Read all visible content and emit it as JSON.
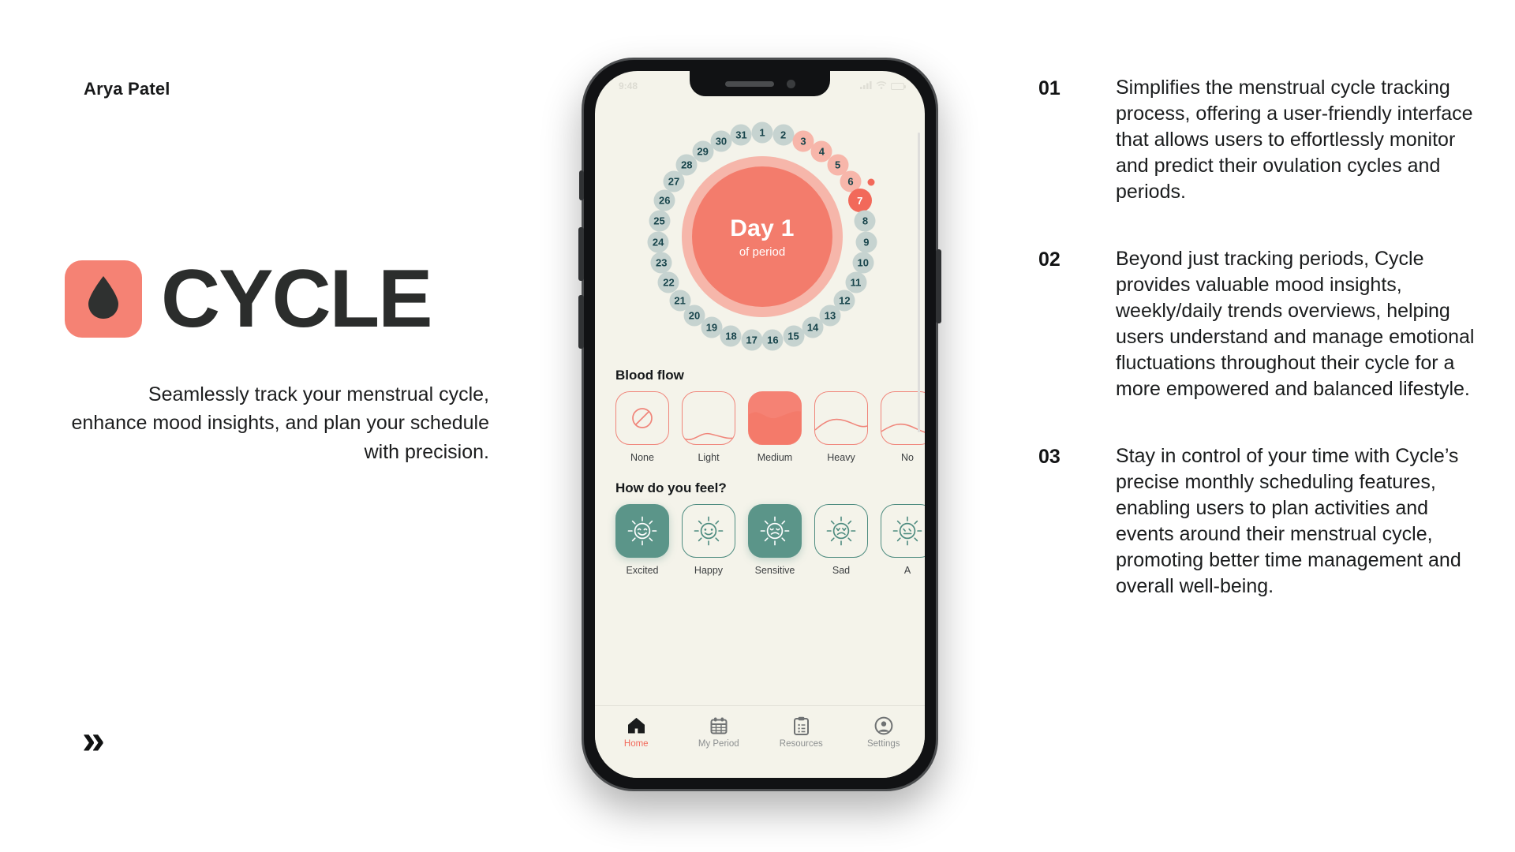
{
  "author": {
    "name": "Arya Patel"
  },
  "brand": {
    "name": "CYCLE",
    "logo_icon": "blood-drop-icon",
    "logo_bg": "#F58274",
    "tagline": "Seamlessly track your menstrual cycle, enhance mood insights, and plan your schedule with precision."
  },
  "footer": {
    "chevron": "»"
  },
  "phone": {
    "status_bar": {
      "time": "9:48",
      "icons": [
        "signal-icon",
        "wifi-icon",
        "battery-icon"
      ]
    },
    "cycle": {
      "center_day": "Day 1",
      "center_sub": "of period",
      "total_days": 31,
      "days": [
        1,
        2,
        3,
        4,
        5,
        6,
        7,
        8,
        9,
        10,
        11,
        12,
        13,
        14,
        15,
        16,
        17,
        18,
        19,
        20,
        21,
        22,
        23,
        24,
        25,
        26,
        27,
        28,
        29,
        30,
        31
      ],
      "flow_days": [
        3,
        4,
        5,
        6
      ],
      "today": 7,
      "colors": {
        "default_dot": "#C6D3D0",
        "flow_dot": "#F7B6AA",
        "today_dot": "#F2695A",
        "core": "#F37C6C",
        "core_glow": "#F6B6AA",
        "screen_bg": "#F4F3EA"
      }
    },
    "blood_flow": {
      "title": "Blood flow",
      "selected": "Medium",
      "options": [
        {
          "label": "None",
          "icon": "no-flow-icon",
          "state": "outline"
        },
        {
          "label": "Light",
          "icon": "light-flow-icon",
          "state": "outline"
        },
        {
          "label": "Medium",
          "icon": "medium-flow-icon",
          "state": "filled"
        },
        {
          "label": "Heavy",
          "icon": "heavy-flow-icon",
          "state": "outline"
        },
        {
          "label": "No",
          "icon": "extra-flow-icon",
          "state": "outline"
        }
      ]
    },
    "mood": {
      "title": "How do you feel?",
      "selected": [
        "Excited",
        "Sensitive"
      ],
      "options": [
        {
          "label": "Excited",
          "icon": "sun-grin-face-icon",
          "state": "selected"
        },
        {
          "label": "Happy",
          "icon": "sun-smile-face-icon",
          "state": "outline"
        },
        {
          "label": "Sensitive",
          "icon": "sun-uneasy-face-icon",
          "state": "selected"
        },
        {
          "label": "Sad",
          "icon": "sun-sad-face-icon",
          "state": "outline"
        },
        {
          "label": "A",
          "icon": "sun-face-icon",
          "state": "outline"
        }
      ]
    },
    "tabbar": {
      "active": "Home",
      "active_color": "#F2695A",
      "items": [
        {
          "label": "Home",
          "icon": "home-icon"
        },
        {
          "label": "My Period",
          "icon": "calendar-icon"
        },
        {
          "label": "Resources",
          "icon": "clipboard-icon"
        },
        {
          "label": "Settings",
          "icon": "account-circle-icon"
        }
      ]
    }
  },
  "features": [
    {
      "number": "01",
      "text": "Simplifies the menstrual cycle tracking process, offering a user-friendly interface that allows users to effortlessly monitor and predict their ovulation cycles and periods."
    },
    {
      "number": "02",
      "text": "Beyond just tracking periods, Cycle provides valuable mood insights, weekly/daily trends overviews, helping users understand and manage emotional fluctuations throughout their cycle for a more empowered and balanced lifestyle."
    },
    {
      "number": "03",
      "text": "Stay in control of your time with Cycle’s precise monthly scheduling features, enabling users to plan activities and events around their menstrual cycle, promoting better time management and overall well-being."
    }
  ]
}
